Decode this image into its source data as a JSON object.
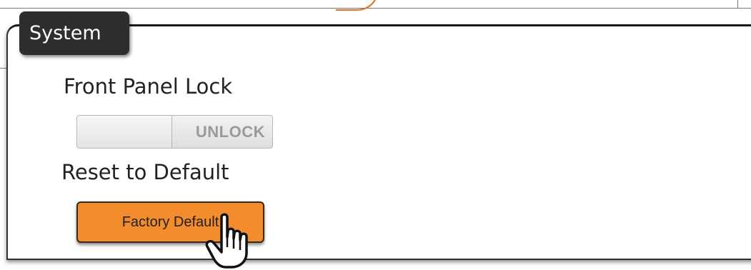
{
  "section": {
    "title": "System"
  },
  "front_panel_lock": {
    "label": "Front Panel Lock",
    "toggle_state": "UNLOCK"
  },
  "reset": {
    "label": "Reset to Default",
    "button_label": "Factory Default"
  },
  "colors": {
    "accent": "#f28c2c",
    "tab_bg": "#2e2e2e"
  },
  "icons": {
    "cursor": "hand-pointer-icon"
  }
}
